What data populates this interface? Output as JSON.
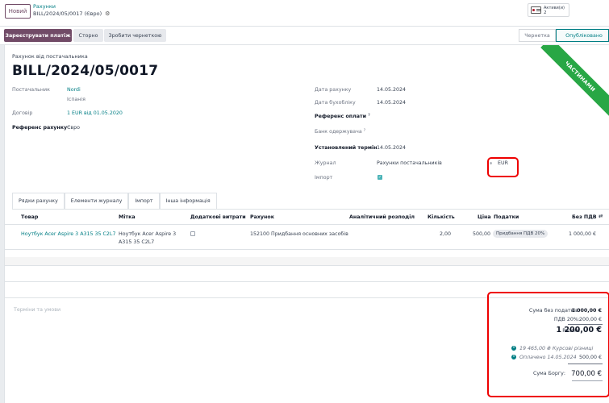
{
  "header": {
    "new_button": "Новий",
    "breadcrumb_parent": "Рахунки",
    "breadcrumb_current": "BILL/2024/05/0017 (Євро)",
    "gear_icon": "gear-icon",
    "smart_button": {
      "label": "Активи(и)",
      "value": "2",
      "icon": "id-card-icon"
    }
  },
  "actions": {
    "register_payment": "Зареєструвати платіж",
    "reverse": "Сторно",
    "reset_draft": "Зробити чернеткою"
  },
  "status_bar": {
    "draft": "Чернетка",
    "posted": "Опубліковано"
  },
  "ribbon": "ЧАСТИНАМИ",
  "form": {
    "doc_type": "Рахунок від постачальника",
    "name": "BILL/2024/05/0017",
    "vendor_label": "Постачальник",
    "vendor_line1": "Nordi",
    "vendor_line2": "Іспанія",
    "contract_label": "Договір",
    "contract_value": "1 EUR від 01.05.2020",
    "reference_label": "Референс рахунку",
    "reference_value": "Євро",
    "bill_date_label": "Дата рахунку",
    "bill_date_value": "14.05.2024",
    "accounting_date_label": "Дата бухобліку",
    "accounting_date_value": "14.05.2024",
    "payment_ref_label": "Референс оплати",
    "recipient_bank_label": "Банк одержувача",
    "due_date_label": "Установлений термін",
    "due_date_value": "14.05.2024",
    "journal_label": "Журнал",
    "journal_value": "Рахунки постачальників",
    "currency_value": "EUR",
    "import_label": "Імпорт",
    "help_mark": "?",
    "check_mark": "✓"
  },
  "tabs": [
    "Рядки рахунку",
    "Елементи журналу",
    "Імпорт",
    "Інша інформація"
  ],
  "table": {
    "columns": {
      "product": "Товар",
      "label": "Мітка",
      "extra": "Додаткові витрати",
      "account": "Рахунок",
      "analytic": "Аналітичний розподіл",
      "qty": "Кількість",
      "price": "Ціна",
      "taxes": "Податки",
      "subtotal": "Без ПДВ"
    },
    "rows": [
      {
        "product": "Ноутбук Acer Aspire 3 A315 35 C2L7",
        "label_line1": "Ноутбук Acer Aspire 3",
        "label_line2": "A315 35 C2L7",
        "account": "152100 Придбання основних засобів",
        "qty": "2,00",
        "price": "500,00",
        "tax": "Придбання ПДВ 20%",
        "subtotal": "1 000,00 €"
      }
    ],
    "settings_icon": "sliders-icon"
  },
  "terms_placeholder": "Терміни та умови",
  "totals": {
    "untaxed_label": "Сума без податків:",
    "untaxed_value": "1 000,00 €",
    "vat_label": "ПДВ 20%:",
    "vat_value": "200,00 €",
    "total_label": "Разом:",
    "total_value": "1 200,00 €",
    "exchange_text": "19 465,00 ₴ Курсові різниці",
    "paid_text": "Оплачено 14.05.2024",
    "paid_value": "500,00 €",
    "due_label": "Сума Боргу:",
    "due_value": "700,00 €",
    "info_icon": "info-icon",
    "info_glyph": "i"
  },
  "colors": {
    "brand": "#714b67",
    "link": "#017e84",
    "ribbon": "#28a745",
    "highlight": "#e00000"
  }
}
